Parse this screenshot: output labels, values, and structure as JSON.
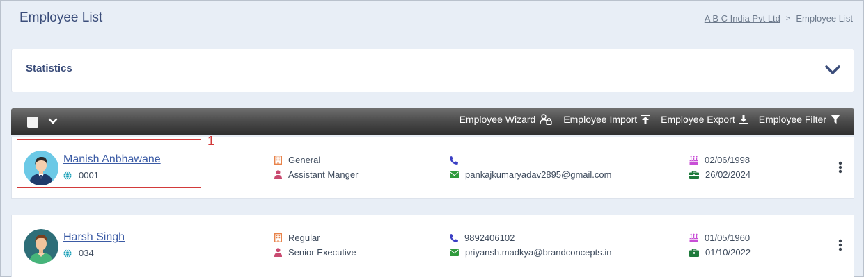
{
  "header": {
    "title": "Employee List",
    "breadcrumb": {
      "company": "A B C India Pvt Ltd",
      "separator": ">",
      "current": "Employee List"
    }
  },
  "statistics": {
    "title": "Statistics"
  },
  "toolbar": {
    "actions": [
      {
        "label": "Employee Wizard",
        "icon": "user-lock-icon"
      },
      {
        "label": "Employee Import",
        "icon": "upload-icon"
      },
      {
        "label": "Employee Export",
        "icon": "download-icon"
      },
      {
        "label": "Employee Filter",
        "icon": "filter-icon"
      }
    ]
  },
  "employees": [
    {
      "name": "Manish Anbhawane",
      "code": "0001",
      "category": "General",
      "designation": "Assistant Manger",
      "phone": "",
      "email": "pankajkumaryadav2895@gmail.com",
      "birth_date": "02/06/1998",
      "join_date": "26/02/2024"
    },
    {
      "name": "Harsh Singh",
      "code": "034",
      "category": "Regular",
      "designation": "Senior Executive",
      "phone": "9892406102",
      "email": "priyansh.madkya@brandconcepts.in",
      "birth_date": "01/05/1960",
      "join_date": "01/10/2022"
    }
  ],
  "annotation": {
    "label": "1"
  },
  "colors": {
    "accent": "#3b4d7a",
    "link": "#3b5ba5",
    "building": "#e8834a",
    "person": "#c94a70",
    "phone": "#3b3fc4",
    "email": "#2f9a3c",
    "cake": "#c84fd6",
    "briefcase": "#1e7a3b",
    "globe": "#1aa0b8",
    "highlight": "#d23a3a"
  }
}
